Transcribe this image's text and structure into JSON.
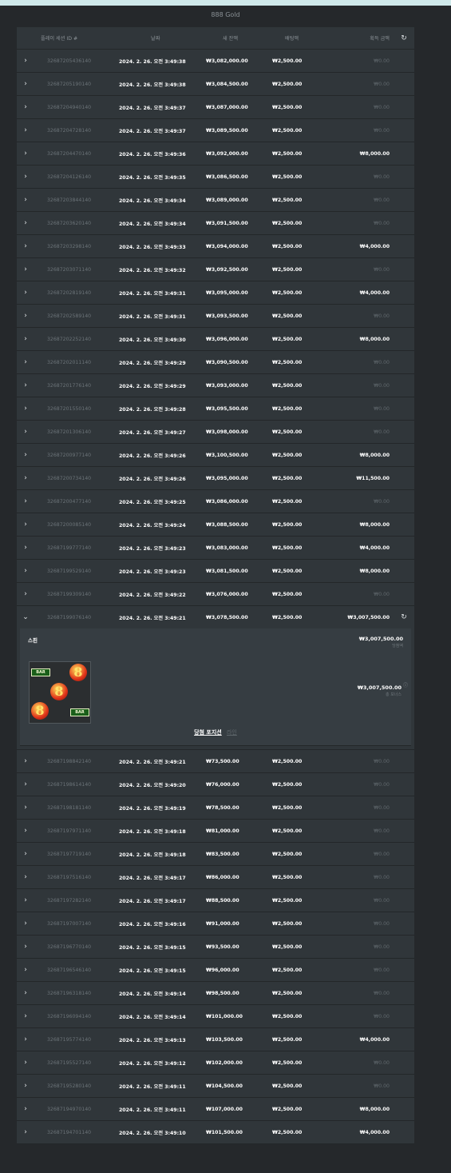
{
  "game_title": "888 Gold",
  "header": {
    "session_id": "플레이 세션 ID #",
    "date": "날짜",
    "balance": "새 잔액",
    "bet": "배팅액",
    "win": "획득 금액"
  },
  "rows_top": [
    {
      "id": "32687205436140",
      "date": "2024. 2. 26. 오전 3:49:38",
      "balance": "₩3,082,000.00",
      "bet": "₩2,500.00",
      "win": "₩0.00",
      "win_pos": false
    },
    {
      "id": "32687205190140",
      "date": "2024. 2. 26. 오전 3:49:38",
      "balance": "₩3,084,500.00",
      "bet": "₩2,500.00",
      "win": "₩0.00",
      "win_pos": false
    },
    {
      "id": "32687204940140",
      "date": "2024. 2. 26. 오전 3:49:37",
      "balance": "₩3,087,000.00",
      "bet": "₩2,500.00",
      "win": "₩0.00",
      "win_pos": false
    },
    {
      "id": "32687204728140",
      "date": "2024. 2. 26. 오전 3:49:37",
      "balance": "₩3,089,500.00",
      "bet": "₩2,500.00",
      "win": "₩0.00",
      "win_pos": false
    },
    {
      "id": "32687204470140",
      "date": "2024. 2. 26. 오전 3:49:36",
      "balance": "₩3,092,000.00",
      "bet": "₩2,500.00",
      "win": "₩8,000.00",
      "win_pos": true
    },
    {
      "id": "32687204126140",
      "date": "2024. 2. 26. 오전 3:49:35",
      "balance": "₩3,086,500.00",
      "bet": "₩2,500.00",
      "win": "₩0.00",
      "win_pos": false
    },
    {
      "id": "32687203844140",
      "date": "2024. 2. 26. 오전 3:49:34",
      "balance": "₩3,089,000.00",
      "bet": "₩2,500.00",
      "win": "₩0.00",
      "win_pos": false
    },
    {
      "id": "32687203620140",
      "date": "2024. 2. 26. 오전 3:49:34",
      "balance": "₩3,091,500.00",
      "bet": "₩2,500.00",
      "win": "₩0.00",
      "win_pos": false
    },
    {
      "id": "32687203298140",
      "date": "2024. 2. 26. 오전 3:49:33",
      "balance": "₩3,094,000.00",
      "bet": "₩2,500.00",
      "win": "₩4,000.00",
      "win_pos": true
    },
    {
      "id": "32687203071140",
      "date": "2024. 2. 26. 오전 3:49:32",
      "balance": "₩3,092,500.00",
      "bet": "₩2,500.00",
      "win": "₩0.00",
      "win_pos": false
    },
    {
      "id": "32687202819140",
      "date": "2024. 2. 26. 오전 3:49:31",
      "balance": "₩3,095,000.00",
      "bet": "₩2,500.00",
      "win": "₩4,000.00",
      "win_pos": true
    },
    {
      "id": "32687202589140",
      "date": "2024. 2. 26. 오전 3:49:31",
      "balance": "₩3,093,500.00",
      "bet": "₩2,500.00",
      "win": "₩0.00",
      "win_pos": false
    },
    {
      "id": "32687202252140",
      "date": "2024. 2. 26. 오전 3:49:30",
      "balance": "₩3,096,000.00",
      "bet": "₩2,500.00",
      "win": "₩8,000.00",
      "win_pos": true
    },
    {
      "id": "32687202011140",
      "date": "2024. 2. 26. 오전 3:49:29",
      "balance": "₩3,090,500.00",
      "bet": "₩2,500.00",
      "win": "₩0.00",
      "win_pos": false
    },
    {
      "id": "32687201776140",
      "date": "2024. 2. 26. 오전 3:49:29",
      "balance": "₩3,093,000.00",
      "bet": "₩2,500.00",
      "win": "₩0.00",
      "win_pos": false
    },
    {
      "id": "32687201550140",
      "date": "2024. 2. 26. 오전 3:49:28",
      "balance": "₩3,095,500.00",
      "bet": "₩2,500.00",
      "win": "₩0.00",
      "win_pos": false
    },
    {
      "id": "32687201306140",
      "date": "2024. 2. 26. 오전 3:49:27",
      "balance": "₩3,098,000.00",
      "bet": "₩2,500.00",
      "win": "₩0.00",
      "win_pos": false
    },
    {
      "id": "32687200977140",
      "date": "2024. 2. 26. 오전 3:49:26",
      "balance": "₩3,100,500.00",
      "bet": "₩2,500.00",
      "win": "₩8,000.00",
      "win_pos": true
    },
    {
      "id": "32687200734140",
      "date": "2024. 2. 26. 오전 3:49:26",
      "balance": "₩3,095,000.00",
      "bet": "₩2,500.00",
      "win": "₩11,500.00",
      "win_pos": true
    },
    {
      "id": "32687200477140",
      "date": "2024. 2. 26. 오전 3:49:25",
      "balance": "₩3,086,000.00",
      "bet": "₩2,500.00",
      "win": "₩0.00",
      "win_pos": false
    },
    {
      "id": "32687200085140",
      "date": "2024. 2. 26. 오전 3:49:24",
      "balance": "₩3,088,500.00",
      "bet": "₩2,500.00",
      "win": "₩8,000.00",
      "win_pos": true
    },
    {
      "id": "32687199777140",
      "date": "2024. 2. 26. 오전 3:49:23",
      "balance": "₩3,083,000.00",
      "bet": "₩2,500.00",
      "win": "₩4,000.00",
      "win_pos": true
    },
    {
      "id": "32687199529140",
      "date": "2024. 2. 26. 오전 3:49:23",
      "balance": "₩3,081,500.00",
      "bet": "₩2,500.00",
      "win": "₩8,000.00",
      "win_pos": true
    },
    {
      "id": "32687199309140",
      "date": "2024. 2. 26. 오전 3:49:22",
      "balance": "₩3,076,000.00",
      "bet": "₩2,500.00",
      "win": "₩0.00",
      "win_pos": false
    }
  ],
  "expanded": {
    "id": "32687199076140",
    "date": "2024. 2. 26. 오전 3:49:21",
    "balance": "₩3,078,500.00",
    "bet": "₩2,500.00",
    "win": "₩3,007,500.00",
    "detail": {
      "label": "스핀",
      "amount": "₩3,007,500.00",
      "amount_sub": "당첨액",
      "amount2": "₩3,007,500.00",
      "amount2_sub": "총 보너스",
      "info": "ⓘ",
      "link1": "당첨 포지션",
      "link2": "라인",
      "reel_bar": "BAR",
      "reel_seven": "8"
    }
  },
  "rows_bottom": [
    {
      "id": "32687198842140",
      "date": "2024. 2. 26. 오전 3:49:21",
      "balance": "₩73,500.00",
      "bet": "₩2,500.00",
      "win": "₩0.00",
      "win_pos": false
    },
    {
      "id": "32687198614140",
      "date": "2024. 2. 26. 오전 3:49:20",
      "balance": "₩76,000.00",
      "bet": "₩2,500.00",
      "win": "₩0.00",
      "win_pos": false
    },
    {
      "id": "32687198181140",
      "date": "2024. 2. 26. 오전 3:49:19",
      "balance": "₩78,500.00",
      "bet": "₩2,500.00",
      "win": "₩0.00",
      "win_pos": false
    },
    {
      "id": "32687197971140",
      "date": "2024. 2. 26. 오전 3:49:18",
      "balance": "₩81,000.00",
      "bet": "₩2,500.00",
      "win": "₩0.00",
      "win_pos": false
    },
    {
      "id": "32687197719140",
      "date": "2024. 2. 26. 오전 3:49:18",
      "balance": "₩83,500.00",
      "bet": "₩2,500.00",
      "win": "₩0.00",
      "win_pos": false
    },
    {
      "id": "32687197516140",
      "date": "2024. 2. 26. 오전 3:49:17",
      "balance": "₩86,000.00",
      "bet": "₩2,500.00",
      "win": "₩0.00",
      "win_pos": false
    },
    {
      "id": "32687197282140",
      "date": "2024. 2. 26. 오전 3:49:17",
      "balance": "₩88,500.00",
      "bet": "₩2,500.00",
      "win": "₩0.00",
      "win_pos": false
    },
    {
      "id": "32687197007140",
      "date": "2024. 2. 26. 오전 3:49:16",
      "balance": "₩91,000.00",
      "bet": "₩2,500.00",
      "win": "₩0.00",
      "win_pos": false
    },
    {
      "id": "32687196770140",
      "date": "2024. 2. 26. 오전 3:49:15",
      "balance": "₩93,500.00",
      "bet": "₩2,500.00",
      "win": "₩0.00",
      "win_pos": false
    },
    {
      "id": "32687196546140",
      "date": "2024. 2. 26. 오전 3:49:15",
      "balance": "₩96,000.00",
      "bet": "₩2,500.00",
      "win": "₩0.00",
      "win_pos": false
    },
    {
      "id": "32687196318140",
      "date": "2024. 2. 26. 오전 3:49:14",
      "balance": "₩98,500.00",
      "bet": "₩2,500.00",
      "win": "₩0.00",
      "win_pos": false
    },
    {
      "id": "32687196094140",
      "date": "2024. 2. 26. 오전 3:49:14",
      "balance": "₩101,000.00",
      "bet": "₩2,500.00",
      "win": "₩0.00",
      "win_pos": false
    },
    {
      "id": "32687195774140",
      "date": "2024. 2. 26. 오전 3:49:13",
      "balance": "₩103,500.00",
      "bet": "₩2,500.00",
      "win": "₩4,000.00",
      "win_pos": true
    },
    {
      "id": "32687195527140",
      "date": "2024. 2. 26. 오전 3:49:12",
      "balance": "₩102,000.00",
      "bet": "₩2,500.00",
      "win": "₩0.00",
      "win_pos": false
    },
    {
      "id": "32687195280140",
      "date": "2024. 2. 26. 오전 3:49:11",
      "balance": "₩104,500.00",
      "bet": "₩2,500.00",
      "win": "₩0.00",
      "win_pos": false
    },
    {
      "id": "32687194970140",
      "date": "2024. 2. 26. 오전 3:49:11",
      "balance": "₩107,000.00",
      "bet": "₩2,500.00",
      "win": "₩8,000.00",
      "win_pos": true
    },
    {
      "id": "32687194701140",
      "date": "2024. 2. 26. 오전 3:49:10",
      "balance": "₩101,500.00",
      "bet": "₩2,500.00",
      "win": "₩4,000.00",
      "win_pos": true
    }
  ],
  "icons": {
    "chevron_right": "›",
    "chevron_down": "⌄",
    "refresh": "↻"
  }
}
